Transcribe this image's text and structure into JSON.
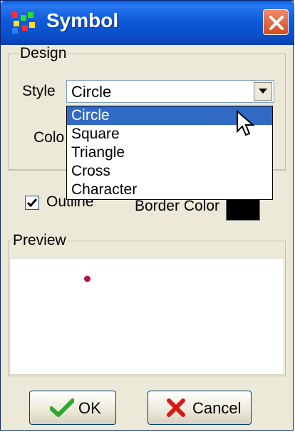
{
  "window": {
    "title": "Symbol"
  },
  "design": {
    "legend": "Design",
    "style_label": "Style",
    "style_value": "Circle",
    "color_label": "Colo",
    "options": [
      "Circle",
      "Square",
      "Triangle",
      "Cross",
      "Character"
    ],
    "selected_option": "Circle"
  },
  "outline": {
    "label": "Outline",
    "checked": true,
    "border_color_label": "Border Color",
    "border_color": "#000000"
  },
  "preview": {
    "legend": "Preview",
    "symbol_color": "#b5173a"
  },
  "buttons": {
    "ok_label": "OK",
    "cancel_label": "Cancel"
  },
  "colors": {
    "titlebar": "#0a4ec8",
    "selection": "#316ac5",
    "close": "#d84a1e"
  },
  "icons": {
    "app": "symbol-app-icon",
    "close": "close-icon",
    "ok": "check-icon",
    "cancel": "x-icon"
  }
}
